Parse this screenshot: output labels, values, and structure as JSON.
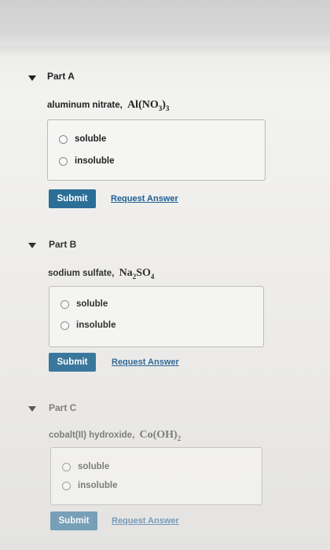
{
  "parts": [
    {
      "title": "Part A",
      "question_prefix": "aluminum nitrate,",
      "formula_main": "Al(NO",
      "formula_sub": "3",
      "formula_close": ")",
      "formula_sub2": "3",
      "options": [
        "soluble",
        "insoluble"
      ],
      "submit_label": "Submit",
      "request_label": "Request Answer"
    },
    {
      "title": "Part B",
      "question_prefix": "sodium sulfate,",
      "formula_main": "Na",
      "formula_sub": "2",
      "formula_close": "SO",
      "formula_sub2": "4",
      "options": [
        "soluble",
        "insoluble"
      ],
      "submit_label": "Submit",
      "request_label": "Request Answer"
    },
    {
      "title": "Part C",
      "question_prefix": "cobalt(II) hydroxide,",
      "formula_main": "Co(OH)",
      "formula_sub": "2",
      "formula_close": "",
      "formula_sub2": "",
      "options": [
        "soluble",
        "insoluble"
      ],
      "submit_label": "Submit",
      "request_label": "Request Answer"
    }
  ]
}
